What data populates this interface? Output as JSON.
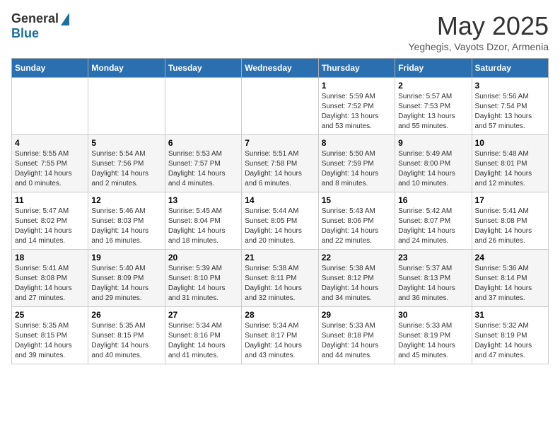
{
  "logo": {
    "general": "General",
    "blue": "Blue"
  },
  "title": "May 2025",
  "subtitle": "Yeghegis, Vayots Dzor, Armenia",
  "days_header": [
    "Sunday",
    "Monday",
    "Tuesday",
    "Wednesday",
    "Thursday",
    "Friday",
    "Saturday"
  ],
  "weeks": [
    [
      {
        "day": "",
        "info": ""
      },
      {
        "day": "",
        "info": ""
      },
      {
        "day": "",
        "info": ""
      },
      {
        "day": "",
        "info": ""
      },
      {
        "day": "1",
        "info": "Sunrise: 5:59 AM\nSunset: 7:52 PM\nDaylight: 13 hours\nand 53 minutes."
      },
      {
        "day": "2",
        "info": "Sunrise: 5:57 AM\nSunset: 7:53 PM\nDaylight: 13 hours\nand 55 minutes."
      },
      {
        "day": "3",
        "info": "Sunrise: 5:56 AM\nSunset: 7:54 PM\nDaylight: 13 hours\nand 57 minutes."
      }
    ],
    [
      {
        "day": "4",
        "info": "Sunrise: 5:55 AM\nSunset: 7:55 PM\nDaylight: 14 hours\nand 0 minutes."
      },
      {
        "day": "5",
        "info": "Sunrise: 5:54 AM\nSunset: 7:56 PM\nDaylight: 14 hours\nand 2 minutes."
      },
      {
        "day": "6",
        "info": "Sunrise: 5:53 AM\nSunset: 7:57 PM\nDaylight: 14 hours\nand 4 minutes."
      },
      {
        "day": "7",
        "info": "Sunrise: 5:51 AM\nSunset: 7:58 PM\nDaylight: 14 hours\nand 6 minutes."
      },
      {
        "day": "8",
        "info": "Sunrise: 5:50 AM\nSunset: 7:59 PM\nDaylight: 14 hours\nand 8 minutes."
      },
      {
        "day": "9",
        "info": "Sunrise: 5:49 AM\nSunset: 8:00 PM\nDaylight: 14 hours\nand 10 minutes."
      },
      {
        "day": "10",
        "info": "Sunrise: 5:48 AM\nSunset: 8:01 PM\nDaylight: 14 hours\nand 12 minutes."
      }
    ],
    [
      {
        "day": "11",
        "info": "Sunrise: 5:47 AM\nSunset: 8:02 PM\nDaylight: 14 hours\nand 14 minutes."
      },
      {
        "day": "12",
        "info": "Sunrise: 5:46 AM\nSunset: 8:03 PM\nDaylight: 14 hours\nand 16 minutes."
      },
      {
        "day": "13",
        "info": "Sunrise: 5:45 AM\nSunset: 8:04 PM\nDaylight: 14 hours\nand 18 minutes."
      },
      {
        "day": "14",
        "info": "Sunrise: 5:44 AM\nSunset: 8:05 PM\nDaylight: 14 hours\nand 20 minutes."
      },
      {
        "day": "15",
        "info": "Sunrise: 5:43 AM\nSunset: 8:06 PM\nDaylight: 14 hours\nand 22 minutes."
      },
      {
        "day": "16",
        "info": "Sunrise: 5:42 AM\nSunset: 8:07 PM\nDaylight: 14 hours\nand 24 minutes."
      },
      {
        "day": "17",
        "info": "Sunrise: 5:41 AM\nSunset: 8:08 PM\nDaylight: 14 hours\nand 26 minutes."
      }
    ],
    [
      {
        "day": "18",
        "info": "Sunrise: 5:41 AM\nSunset: 8:08 PM\nDaylight: 14 hours\nand 27 minutes."
      },
      {
        "day": "19",
        "info": "Sunrise: 5:40 AM\nSunset: 8:09 PM\nDaylight: 14 hours\nand 29 minutes."
      },
      {
        "day": "20",
        "info": "Sunrise: 5:39 AM\nSunset: 8:10 PM\nDaylight: 14 hours\nand 31 minutes."
      },
      {
        "day": "21",
        "info": "Sunrise: 5:38 AM\nSunset: 8:11 PM\nDaylight: 14 hours\nand 32 minutes."
      },
      {
        "day": "22",
        "info": "Sunrise: 5:38 AM\nSunset: 8:12 PM\nDaylight: 14 hours\nand 34 minutes."
      },
      {
        "day": "23",
        "info": "Sunrise: 5:37 AM\nSunset: 8:13 PM\nDaylight: 14 hours\nand 36 minutes."
      },
      {
        "day": "24",
        "info": "Sunrise: 5:36 AM\nSunset: 8:14 PM\nDaylight: 14 hours\nand 37 minutes."
      }
    ],
    [
      {
        "day": "25",
        "info": "Sunrise: 5:35 AM\nSunset: 8:15 PM\nDaylight: 14 hours\nand 39 minutes."
      },
      {
        "day": "26",
        "info": "Sunrise: 5:35 AM\nSunset: 8:15 PM\nDaylight: 14 hours\nand 40 minutes."
      },
      {
        "day": "27",
        "info": "Sunrise: 5:34 AM\nSunset: 8:16 PM\nDaylight: 14 hours\nand 41 minutes."
      },
      {
        "day": "28",
        "info": "Sunrise: 5:34 AM\nSunset: 8:17 PM\nDaylight: 14 hours\nand 43 minutes."
      },
      {
        "day": "29",
        "info": "Sunrise: 5:33 AM\nSunset: 8:18 PM\nDaylight: 14 hours\nand 44 minutes."
      },
      {
        "day": "30",
        "info": "Sunrise: 5:33 AM\nSunset: 8:19 PM\nDaylight: 14 hours\nand 45 minutes."
      },
      {
        "day": "31",
        "info": "Sunrise: 5:32 AM\nSunset: 8:19 PM\nDaylight: 14 hours\nand 47 minutes."
      }
    ]
  ]
}
